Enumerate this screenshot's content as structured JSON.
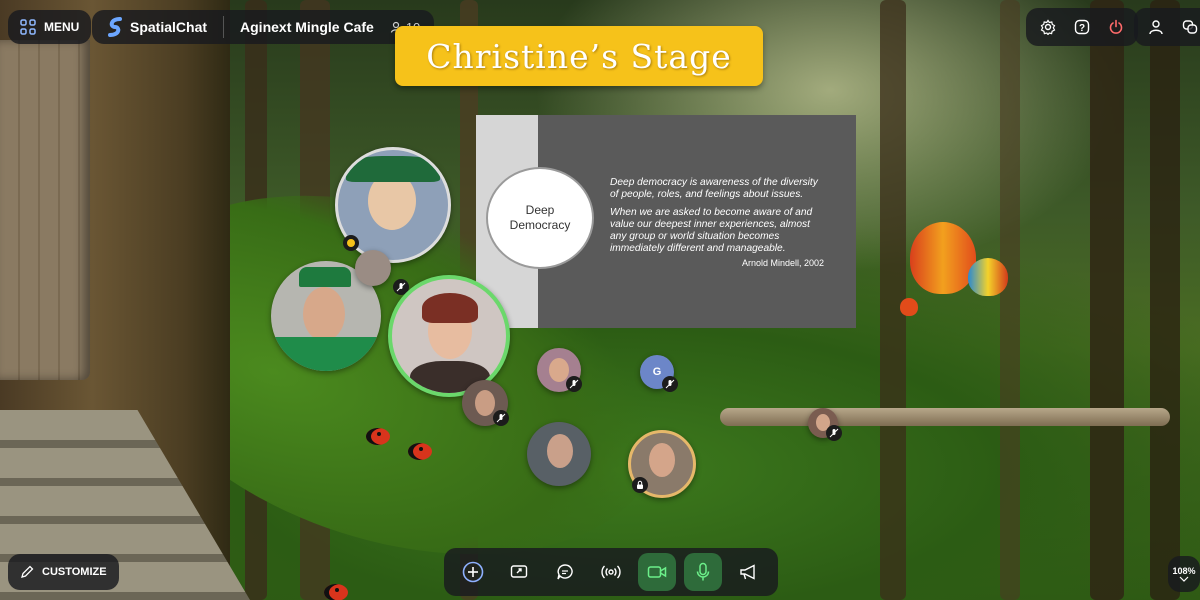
{
  "app": {
    "name": "SpatialChat",
    "menu_label": "MENU"
  },
  "room": {
    "name": "Aginext Mingle Cafe",
    "participant_count": "10"
  },
  "stage": {
    "title": "Christine’s Stage"
  },
  "slide": {
    "circle_text": "Deep\nDemocracy",
    "paragraph_1": "Deep democracy is awareness of the diversity of people, roles, and feelings about issues.",
    "paragraph_2": "When we are asked to become aware of and value our deepest inner experiences, almost any group or world situation becomes immediately different and manageable.",
    "author": "Arnold Mindell, 2002"
  },
  "avatars": [
    {
      "id": "a1",
      "initial": ""
    },
    {
      "id": "g",
      "initial": "G"
    }
  ],
  "top_right_icons": [
    "gear-icon",
    "help-icon",
    "power-icon",
    "user-icon",
    "chat-bubbles-icon"
  ],
  "bottom_left": {
    "customize_label": "CUSTOMIZE"
  },
  "toolbar_icons": [
    "plus-icon",
    "screen-share-icon",
    "chat-icon",
    "broadcast-icon",
    "camera-icon",
    "microphone-icon",
    "megaphone-icon"
  ],
  "zoom": {
    "value": "108%"
  },
  "colors": {
    "stage_banner": "#f6c21a",
    "active_toggle": "#2e6b3a",
    "danger": "#ff6b6b"
  }
}
